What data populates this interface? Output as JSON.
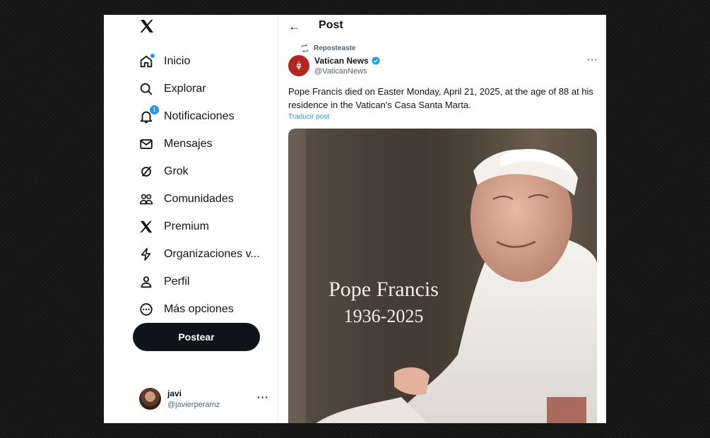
{
  "sidebar": {
    "logo": "x-logo-icon",
    "items": [
      {
        "label": "Inicio",
        "icon": "home-icon"
      },
      {
        "label": "Explorar",
        "icon": "search-icon"
      },
      {
        "label": "Notificaciones",
        "icon": "bell-icon",
        "badge": "1"
      },
      {
        "label": "Mensajes",
        "icon": "mail-icon"
      },
      {
        "label": "Grok",
        "icon": "grok-icon"
      },
      {
        "label": "Comunidades",
        "icon": "communities-icon"
      },
      {
        "label": "Premium",
        "icon": "x-logo-icon"
      },
      {
        "label": "Organizaciones v...",
        "icon": "lightning-icon"
      },
      {
        "label": "Perfil",
        "icon": "person-icon"
      },
      {
        "label": "Más opciones",
        "icon": "more-circle-icon"
      }
    ],
    "post_button": "Postear",
    "account": {
      "name": "javi",
      "handle": "@javierperamz",
      "more": "···"
    }
  },
  "main": {
    "back": "←",
    "title": "Post",
    "repost_label": "Reposteaste",
    "author": {
      "name": "Vatican News",
      "handle": "@VaticanNews",
      "verified": true
    },
    "more": "···",
    "text": "Pope Francis died on Easter Monday, April 21, 2025, at the age of 88 at his residence in the Vatican's Casa Santa Marta.",
    "translate": "Traducir post",
    "image": {
      "title": "Pope Francis",
      "years": "1936-2025"
    }
  },
  "colors": {
    "accent": "#1d9bf0",
    "text": "#0f1419",
    "muted": "#536471",
    "vatican_red": "#b5251f"
  }
}
